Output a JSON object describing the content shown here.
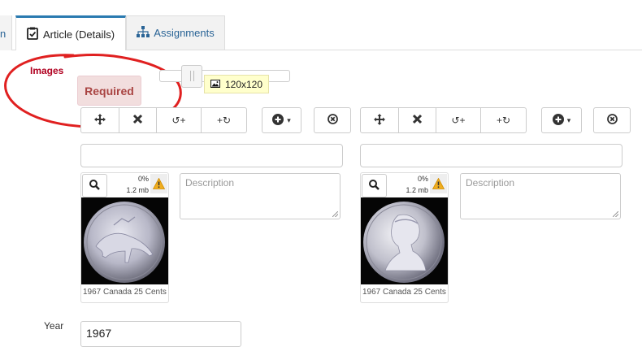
{
  "tabs": {
    "cut_label": "n",
    "active": {
      "label": "Article (Details)",
      "icon": "clipboard-check-icon"
    },
    "inactive": {
      "label": "Assignments",
      "icon": "sitemap-icon"
    }
  },
  "images": {
    "label": "Images",
    "required_badge": "Required",
    "size_tooltip": "120x120",
    "slider_level": 0.2
  },
  "toolbar": {
    "move_icon": "move-icon",
    "delete_icon": "close-icon",
    "rotate_left": "↺+",
    "rotate_right": "+↻",
    "add_caret": "▾",
    "remove_icon": "circle-x-icon"
  },
  "cards": [
    {
      "progress": "0%",
      "size": "1.2 mb",
      "caption": "1967 Canada 25 Cents",
      "description_placeholder": "Description",
      "image": "caribou-coin"
    },
    {
      "progress": "0%",
      "size": "1.2 mb",
      "caption": "1967 Canada 25 Cents",
      "description_placeholder": "Description",
      "image": "queen-coin"
    }
  ],
  "year": {
    "label": "Year",
    "value": "1967"
  },
  "colors": {
    "accent": "#2a7ab0",
    "required_bg": "#f2dede",
    "required_text": "#a94442",
    "annotation": "#e02020"
  }
}
